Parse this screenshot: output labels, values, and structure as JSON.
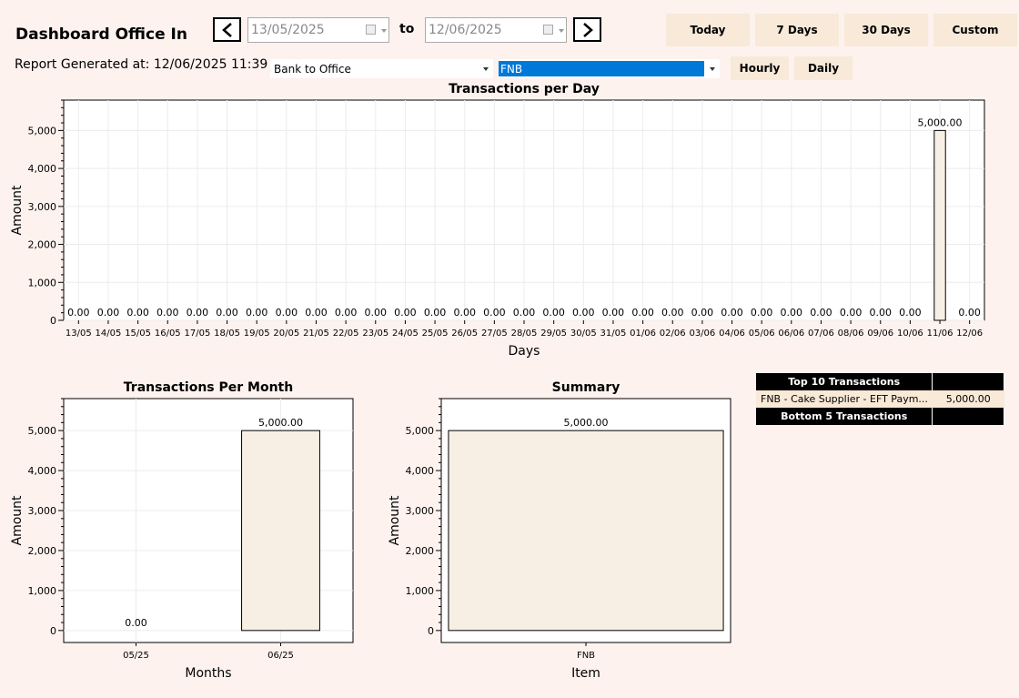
{
  "header": {
    "title": "Dashboard Office In",
    "report_generated": "Report Generated at: 12/06/2025 11:39"
  },
  "date_range": {
    "from": "13/05/2025",
    "to_label": "to",
    "to": "12/06/2025"
  },
  "range_buttons": [
    "Today",
    "7 Days",
    "30 Days",
    "Custom"
  ],
  "filters": {
    "category": "Bank to Office",
    "bank": "FNB"
  },
  "granularity_buttons": [
    "Hourly",
    "Daily"
  ],
  "colors": {
    "background": "#fdf2ee",
    "bar_fill": "#f8efe4",
    "bar_stroke": "#000000",
    "button": "#f8e9d9",
    "selected": "#0078d7"
  },
  "chart_data": [
    {
      "type": "bar",
      "title": "Transactions per Day",
      "xlabel": "Days",
      "ylabel": "Amount",
      "ylim": [
        0,
        5800
      ],
      "yticks": [
        "0",
        "1,000",
        "2,000",
        "3,000",
        "4,000",
        "5,000"
      ],
      "categories": [
        "13/05",
        "14/05",
        "15/05",
        "16/05",
        "17/05",
        "18/05",
        "19/05",
        "20/05",
        "21/05",
        "22/05",
        "23/05",
        "24/05",
        "25/05",
        "26/05",
        "27/05",
        "28/05",
        "29/05",
        "30/05",
        "31/05",
        "01/06",
        "02/06",
        "03/06",
        "04/06",
        "05/06",
        "06/06",
        "07/06",
        "08/06",
        "09/06",
        "10/06",
        "11/06",
        "12/06"
      ],
      "values": [
        0,
        0,
        0,
        0,
        0,
        0,
        0,
        0,
        0,
        0,
        0,
        0,
        0,
        0,
        0,
        0,
        0,
        0,
        0,
        0,
        0,
        0,
        0,
        0,
        0,
        0,
        0,
        0,
        0,
        5000,
        0
      ],
      "data_labels": [
        "0.00",
        "0.00",
        "0.00",
        "0.00",
        "0.00",
        "0.00",
        "0.00",
        "0.00",
        "0.00",
        "0.00",
        "0.00",
        "0.00",
        "0.00",
        "0.00",
        "0.00",
        "0.00",
        "0.00",
        "0.00",
        "0.00",
        "0.00",
        "0.00",
        "0.00",
        "0.00",
        "0.00",
        "0.00",
        "0.00",
        "0.00",
        "0.00",
        "0.00",
        "5,000.00",
        "0.00"
      ],
      "grid": true
    },
    {
      "type": "bar",
      "title": "Transactions Per Month",
      "xlabel": "Months",
      "ylabel": "Amount",
      "ylim": [
        -300,
        5800
      ],
      "yticks": [
        "0",
        "1,000",
        "2,000",
        "3,000",
        "4,000",
        "5,000"
      ],
      "categories": [
        "05/25",
        "06/25"
      ],
      "values": [
        0,
        5000
      ],
      "data_labels": [
        "0.00",
        "5,000.00"
      ],
      "grid": true
    },
    {
      "type": "bar",
      "title": "Summary",
      "xlabel": "Item",
      "ylabel": "Amount",
      "ylim": [
        -300,
        5800
      ],
      "yticks": [
        "0",
        "1,000",
        "2,000",
        "3,000",
        "4,000",
        "5,000"
      ],
      "categories": [
        "FNB"
      ],
      "values": [
        5000
      ],
      "data_labels": [
        "5,000.00"
      ],
      "grid": false
    }
  ],
  "transactions": {
    "top_header": "Top 10 Transactions",
    "top_rows": [
      {
        "description": "FNB - Cake Supplier - EFT Paym...",
        "amount": "5,000.00"
      }
    ],
    "bottom_header": "Bottom 5 Transactions"
  }
}
